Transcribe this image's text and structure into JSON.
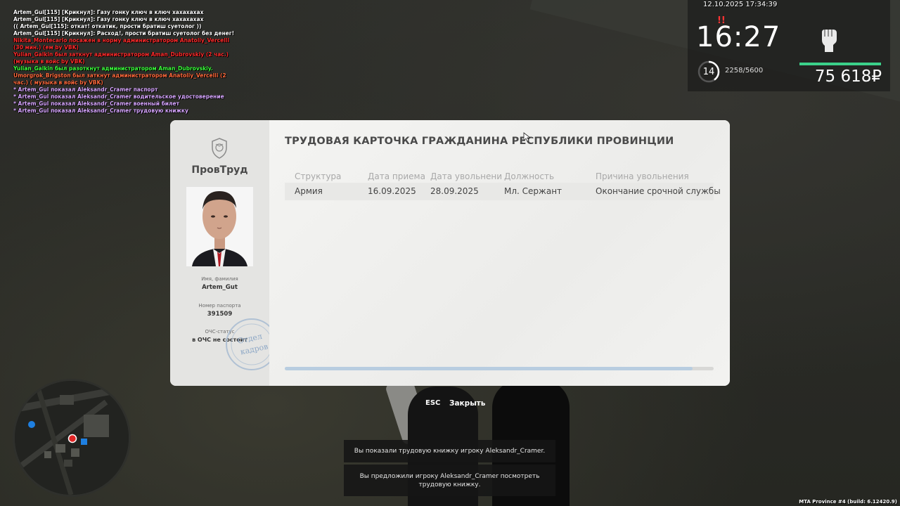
{
  "chat": [
    {
      "text": "Artem_Gul[115] [Крикнул]: Газу гонку ключ в ключ хахахахах",
      "color": "white"
    },
    {
      "text": "Artem_Gul[115] [Крикнул]: Газу гонку ключ в ключ хахахахах",
      "color": "white"
    },
    {
      "text": "(( Artem_Gul[115]: откат! откатик, прости братиш суетолог ))",
      "color": "white"
    },
    {
      "text": "Artem_Gul[115] [Крикнул]: Расход!, прости братиш суетолог без денег!",
      "color": "white"
    },
    {
      "text": "Nikita_Montecarlo посажен в норму администратором Anatoliy_Vercelli (30 мин.) (ем by VBK)",
      "color": "red"
    },
    {
      "text": "Yulian_Galkin был заткнут администратором Aman_Dubrovskiy (2 час.) (музыка в войс by VBK)",
      "color": "red"
    },
    {
      "text": "Yulian_Galkin был разоткнут администратором Aman_Dubrovskiy.",
      "color": "green"
    },
    {
      "text": "Umorgrok_Brigston был заткнут администратором Anatoliy_Vercelli (2 час.) ( музыка в войс by VBK)",
      "color": "orange"
    },
    {
      "text": "* Artem_Gul показал Aleksandr_Cramer паспорт",
      "color": "purple"
    },
    {
      "text": "* Artem_Gul показал Aleksandr_Cramer водительское удостоверение",
      "color": "purple"
    },
    {
      "text": "* Artem_Gul показал Aleksandr_Cramer военный билет",
      "color": "purple"
    },
    {
      "text": "* Artem_Gul показал Aleksandr_Cramer трудовую книжку",
      "color": "purple"
    }
  ],
  "hud": {
    "datetime": "12.10.2025 17:34:39",
    "marker": "!!",
    "time": "16:27",
    "level": "14",
    "xp": "2258/5600",
    "xp_progress": 0.403,
    "money": "75 618₽",
    "health_color": "#3bd18a",
    "weapon_icon": "fist-icon"
  },
  "modal": {
    "org_name": "ПровТруд",
    "title": "ТРУДОВАЯ КАРТОЧКА ГРАЖДАНИНА РЕСПУБЛИКИ ПРОВИНЦИИ",
    "name_label": "Имя, фамилия",
    "name_value": "Artem_Gut",
    "passport_label": "Номер паспорта",
    "passport_value": "391509",
    "ochs_label": "ОЧС-статус",
    "ochs_value": "в ОЧС не состоит",
    "stamp_text_1": "Отдел",
    "stamp_text_2": "кадров",
    "columns": [
      "Структура",
      "Дата приема",
      "Дата увольнени",
      "Должность",
      "Причина увольнения"
    ],
    "rows": [
      [
        "Армия",
        "16.09.2025",
        "28.09.2025",
        "Мл. Сержант",
        "Окончание срочной службы"
      ]
    ],
    "scroll_progress": 0.95
  },
  "close": {
    "key": "ESC",
    "label": "Закрыть"
  },
  "notifications": [
    "Вы показали трудовую книжку игроку Aleksandr_Cramer.",
    "Вы предложили игроку Aleksandr_Cramer посмотреть трудовую книжку."
  ],
  "build": "MTA Province #4 (build: 6.12420.9)"
}
